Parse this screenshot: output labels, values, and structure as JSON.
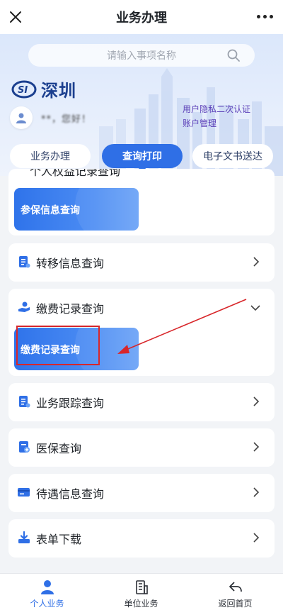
{
  "header": {
    "title": "业务办理"
  },
  "search": {
    "placeholder": "请输入事项名称"
  },
  "brand": {
    "city": "深圳",
    "mark_text": "SI"
  },
  "user": {
    "name": "**，您好！",
    "links": [
      "用户隐私二次认证",
      "账户管理"
    ]
  },
  "tabs": [
    {
      "label": "业务办理",
      "active": false
    },
    {
      "label": "查询打印",
      "active": true
    },
    {
      "label": "电子文书送达",
      "active": false
    }
  ],
  "first_card": {
    "partial_label": "个人权益记录查询",
    "sub_button": "参保信息查询"
  },
  "rows": [
    {
      "label": "转移信息查询",
      "icon": "document-icon",
      "expanded": false
    },
    {
      "label": "缴费记录查询",
      "icon": "hand-coin-icon",
      "expanded": true,
      "sub_button": "缴费记录查询"
    },
    {
      "label": "业务跟踪查询",
      "icon": "document-icon",
      "expanded": false
    },
    {
      "label": "医保查询",
      "icon": "medical-doc-icon",
      "expanded": false
    },
    {
      "label": "待遇信息查询",
      "icon": "card-icon",
      "expanded": false
    },
    {
      "label": "表单下载",
      "icon": "download-icon",
      "expanded": false
    }
  ],
  "bottom_nav": [
    {
      "label": "个人业务",
      "icon": "person-icon",
      "active": true
    },
    {
      "label": "单位业务",
      "icon": "building-icon",
      "active": false
    },
    {
      "label": "返回首页",
      "icon": "back-arrow-icon",
      "active": false
    }
  ],
  "colors": {
    "accent": "#2f6fe6",
    "annotation": "#d8262a",
    "link": "#5b3fb8",
    "brand": "#1b3f8f"
  }
}
